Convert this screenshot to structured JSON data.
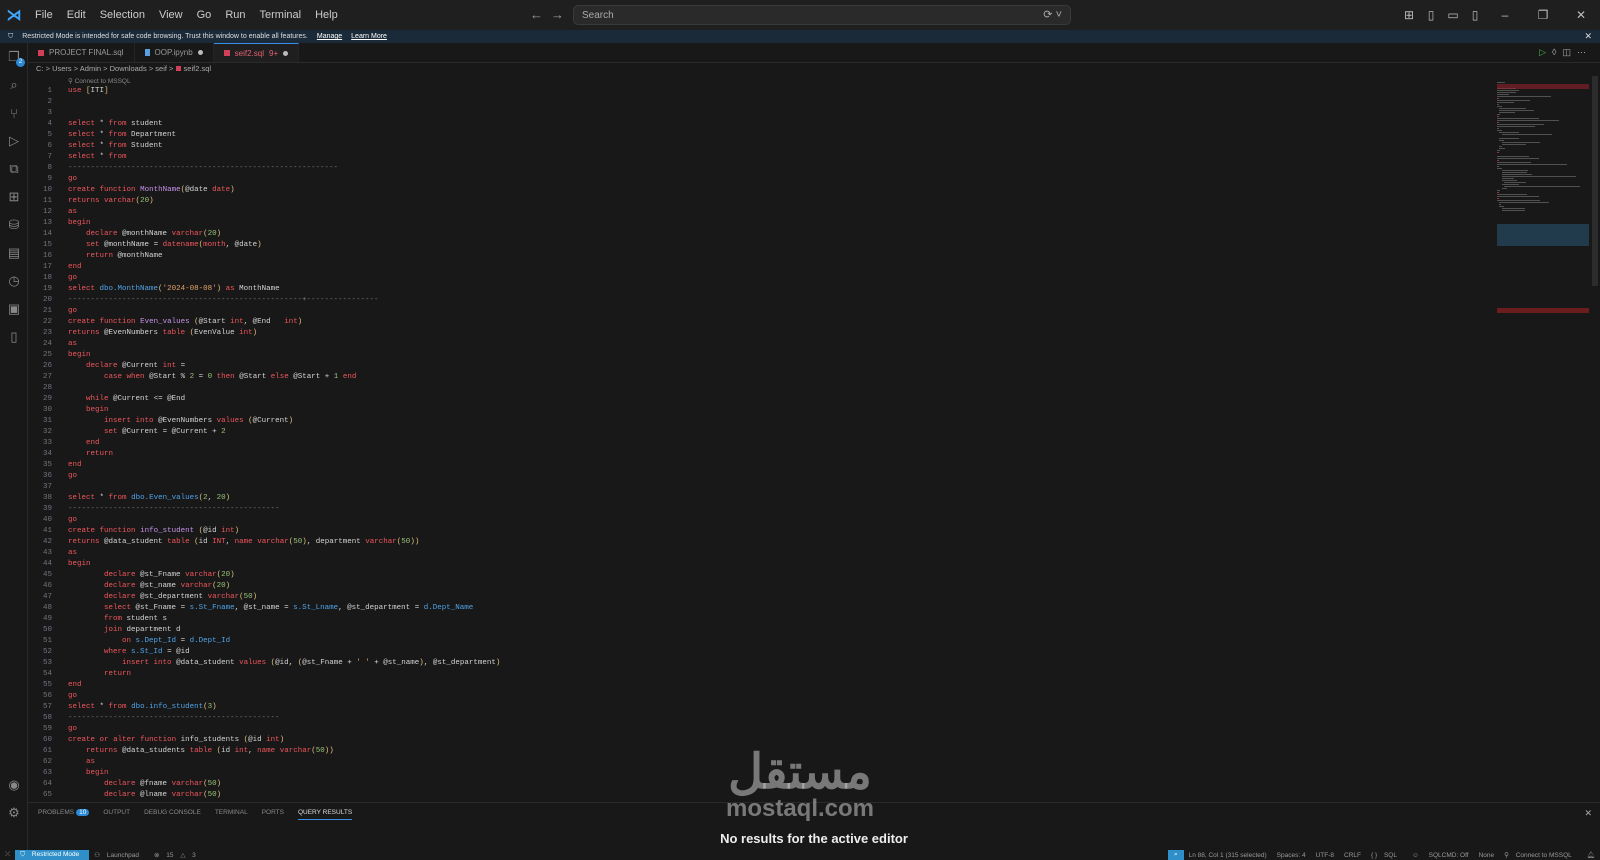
{
  "titlebar": {
    "menu": [
      "File",
      "Edit",
      "Selection",
      "View",
      "Go",
      "Run",
      "Terminal",
      "Help"
    ],
    "search_placeholder": "Search"
  },
  "banner": {
    "text": "Restricted Mode is intended for safe code browsing. Trust this window to enable all features.",
    "manage": "Manage",
    "learn_more": "Learn More"
  },
  "activity": {
    "explorer_badge": "2"
  },
  "tabs": [
    {
      "label": "PROJECT FINAL.sql",
      "icon": "sql"
    },
    {
      "label": "OOP.ipynb",
      "icon": "notebook",
      "dirty": true
    },
    {
      "label": "seif2.sql",
      "badge": "9+",
      "icon": "sql",
      "dirty": true,
      "active": true
    }
  ],
  "breadcrumb": [
    "C:",
    "Users",
    "Admin",
    "Downloads",
    "seif",
    "seif2.sql"
  ],
  "codelens": "Connect to MSSQL",
  "code": [
    "use [ITI]",
    "",
    "",
    "select * from student",
    "select * from Department",
    "select * from Student",
    "select * from",
    "------------------------------------------------------------",
    "go",
    "create function MonthName(@date date)",
    "returns varchar(20)",
    "as",
    "begin",
    "    declare @monthName varchar(20)",
    "    set @monthName = datename(month, @date)",
    "    return @monthName",
    "end",
    "go",
    "select dbo.MonthName('2024-08-08') as MonthName",
    "----------------------------------------------------+----------------",
    "go",
    "create function Even_values (@Start int, @End   int)",
    "returns @EvenNumbers table (EvenValue int)",
    "as",
    "begin",
    "    declare @Current int =",
    "        case when @Start % 2 = 0 then @Start else @Start + 1 end",
    "",
    "    while @Current <= @End",
    "    begin",
    "        insert into @EvenNumbers values (@Current)",
    "        set @Current = @Current + 2",
    "    end",
    "    return",
    "end",
    "go",
    "",
    "select * from dbo.Even_values(2, 20)",
    "-----------------------------------------------",
    "go",
    "create function info_student (@id int)",
    "returns @data_student table (id INT, name varchar(50), department varchar(50))",
    "as",
    "begin",
    "        declare @st_Fname varchar(20)",
    "        declare @st_name varchar(20)",
    "        declare @st_department varchar(50)",
    "        select @st_Fname = s.St_Fname, @st_name = s.St_Lname, @st_department = d.Dept_Name",
    "        from student s",
    "        join department d",
    "            on s.Dept_Id = d.Dept_Id",
    "        where s.St_Id = @id",
    "            insert into @data_student values (@id, (@st_Fname + ' ' + @st_name), @st_department)",
    "        return",
    "end",
    "go",
    "select * from dbo.info_student(3)",
    "-----------------------------------------------",
    "go",
    "create or alter function info_students (@id int)",
    "    returns @data_students table (id int, name varchar(50))",
    "    as",
    "    begin",
    "        declare @fname varchar(50)",
    "        declare @lname varchar(50)"
  ],
  "panel": {
    "tabs": [
      "PROBLEMS",
      "OUTPUT",
      "DEBUG CONSOLE",
      "TERMINAL",
      "PORTS",
      "QUERY RESULTS"
    ],
    "problems_count": "10",
    "active_tab": "QUERY RESULTS",
    "message": "No results for the active editor"
  },
  "watermark": {
    "arabic": "مستقل",
    "latin": "mostaql.com"
  },
  "status": {
    "restricted": "Restricted Mode",
    "launchpad": "Launchpad",
    "errors": "15",
    "warnings": "3",
    "position": "Ln 88, Col 1 (315 selected)",
    "spaces": "Spaces: 4",
    "encoding": "UTF-8",
    "eol": "CRLF",
    "language": "SQL",
    "sqlcmd": "SQLCMD: Off",
    "none": "None",
    "connect": "Connect to MSSQL"
  },
  "colors": {
    "accent": "#3a8ee6",
    "keyword": "#f0565c",
    "function": "#c792ea",
    "object": "#4fa3e8"
  }
}
